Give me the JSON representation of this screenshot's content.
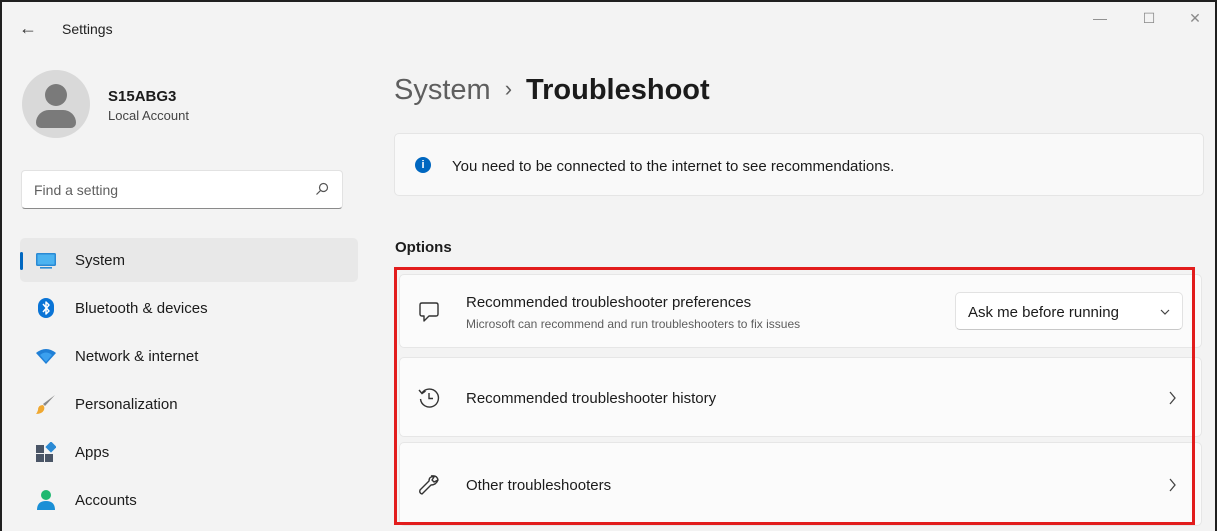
{
  "window": {
    "title": "Settings",
    "back_glyph": "←",
    "minimize_glyph": "—",
    "maximize_glyph": "☐",
    "close_glyph": "✕"
  },
  "profile": {
    "name": "S15ABG3",
    "account_type": "Local Account"
  },
  "search": {
    "placeholder": "Find a setting",
    "value": ""
  },
  "sidebar": {
    "items": [
      {
        "label": "System",
        "icon": "system-icon",
        "active": true
      },
      {
        "label": "Bluetooth & devices",
        "icon": "bluetooth-icon",
        "active": false
      },
      {
        "label": "Network & internet",
        "icon": "wifi-icon",
        "active": false
      },
      {
        "label": "Personalization",
        "icon": "brush-icon",
        "active": false
      },
      {
        "label": "Apps",
        "icon": "apps-icon",
        "active": false
      },
      {
        "label": "Accounts",
        "icon": "person-icon",
        "active": false
      }
    ]
  },
  "breadcrumb": {
    "parent": "System",
    "separator": "›",
    "current": "Troubleshoot"
  },
  "infobar": {
    "icon_glyph": "i",
    "text": "You need to be connected to the internet to see recommendations."
  },
  "options": {
    "section_title": "Options",
    "cards": [
      {
        "title": "Recommended troubleshooter preferences",
        "description": "Microsoft can recommend and run troubleshooters to fix issues",
        "icon": "chat-bubble-icon",
        "control": {
          "type": "dropdown",
          "selected": "Ask me before running"
        }
      },
      {
        "title": "Recommended troubleshooter history",
        "icon": "history-icon",
        "control": {
          "type": "chevron"
        }
      },
      {
        "title": "Other troubleshooters",
        "icon": "wrench-icon",
        "control": {
          "type": "chevron"
        }
      }
    ]
  },
  "colors": {
    "accent": "#0067c0",
    "highlight": "#e21c1c",
    "background": "#f3f3f3"
  }
}
